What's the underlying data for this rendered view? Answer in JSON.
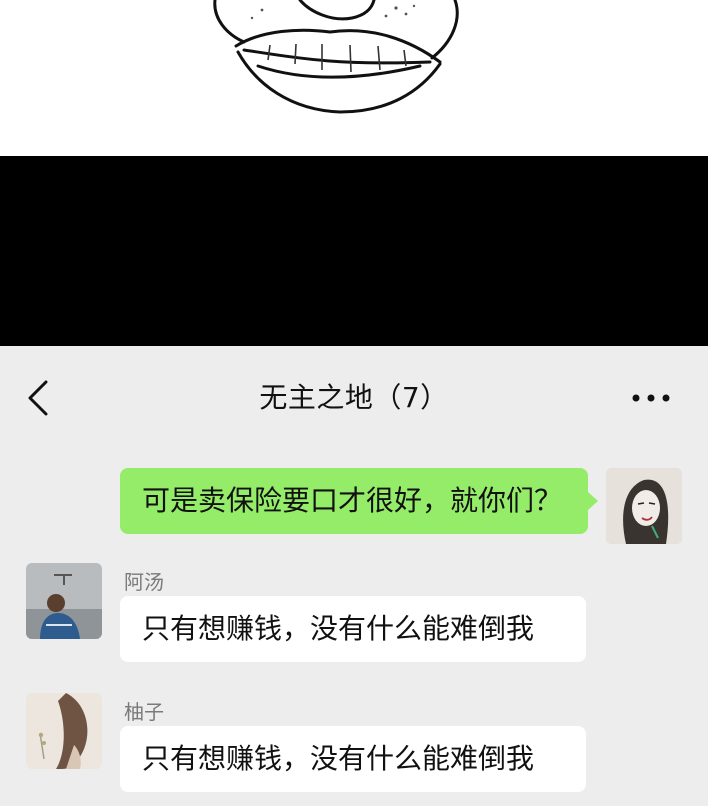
{
  "chat": {
    "title": "无主之地（7）",
    "icons": {
      "back": "chevron-left-icon",
      "more": "more-dots-icon"
    },
    "messages": [
      {
        "sender": "",
        "text": "可是卖保险要口才很好，就你们？",
        "outgoing": true
      },
      {
        "sender": "阿汤",
        "text": "只有想赚钱，没有什么能难倒我",
        "outgoing": false
      },
      {
        "sender": "柚子",
        "text": "只有想赚钱，没有什么能难倒我",
        "outgoing": false
      }
    ]
  },
  "colors": {
    "chat_bg": "#ededed",
    "outgoing_bubble": "#95ec69",
    "incoming_bubble": "#ffffff",
    "band": "#000000"
  }
}
